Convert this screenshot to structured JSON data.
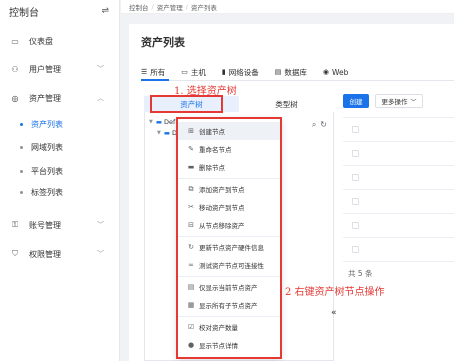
{
  "sidebar": {
    "title": "控制台",
    "toggle_icon": "menu-fold-icon",
    "items": [
      {
        "label": "仪表盘",
        "icon": "dashboard-icon"
      },
      {
        "label": "用户管理",
        "icon": "users-icon"
      },
      {
        "label": "资产管理",
        "icon": "asset-icon"
      },
      {
        "label": "账号管理",
        "icon": "account-icon"
      },
      {
        "label": "权限管理",
        "icon": "permission-icon"
      }
    ],
    "asset_sub": [
      "资产列表",
      "网域列表",
      "平台列表",
      "标签列表"
    ],
    "active_sub": "资产列表"
  },
  "breadcrumb": [
    "控制台",
    "资产管理",
    "资产列表"
  ],
  "page_title": "资产列表",
  "tabs": [
    {
      "label": "所有",
      "icon": "list-icon"
    },
    {
      "label": "主机",
      "icon": "host-icon"
    },
    {
      "label": "网络设备",
      "icon": "network-icon"
    },
    {
      "label": "数据库",
      "icon": "database-icon"
    },
    {
      "label": "Web",
      "icon": "web-icon"
    }
  ],
  "tree_tabs": [
    "资产树",
    "类型树"
  ],
  "tree_nodes": [
    "Def",
    "De"
  ],
  "toolbar": {
    "create": "创建",
    "more": "更多操作"
  },
  "total": "共 5 条",
  "context_menu": [
    {
      "label": "创建节点",
      "icon": "plus-square-icon"
    },
    {
      "label": "重命名节点",
      "icon": "edit-icon"
    },
    {
      "label": "删除节点",
      "icon": "delete-icon"
    },
    {
      "label": "添加资产到节点",
      "icon": "copy-icon"
    },
    {
      "label": "移动资产到节点",
      "icon": "scissors-icon"
    },
    {
      "label": "从节点移除资产",
      "icon": "remove-icon"
    },
    {
      "label": "更新节点资产硬件信息",
      "icon": "refresh-icon"
    },
    {
      "label": "测试资产节点可连接性",
      "icon": "link-icon"
    },
    {
      "label": "仅显示当前节点资产",
      "icon": "list-icon"
    },
    {
      "label": "显示所有子节点资产",
      "icon": "list-all-icon"
    },
    {
      "label": "校对资产数量",
      "icon": "check-icon"
    },
    {
      "label": "显示节点详情",
      "icon": "info-icon"
    }
  ],
  "annotations": {
    "step1": "1. 选择资产树",
    "step2": "2 右键资产树节点操作",
    "color": "#e53935"
  }
}
